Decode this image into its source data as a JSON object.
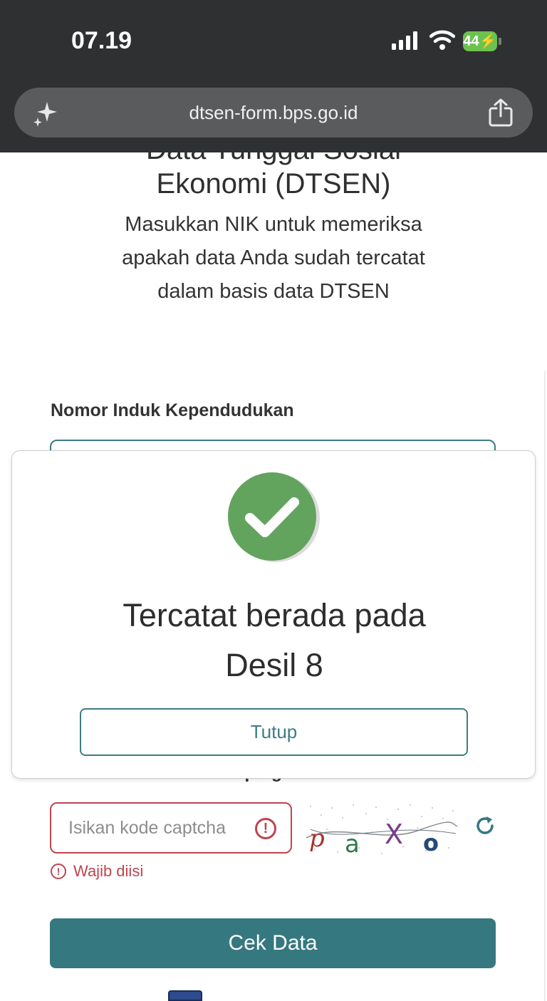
{
  "status_bar": {
    "time": "07.19",
    "battery": "44"
  },
  "browser": {
    "url": "dtsen-form.bps.go.id"
  },
  "header": {
    "title": "Data Tunggal Sosial\nEkonomi (DTSEN)",
    "subtitle": "Masukkan NIK untuk memeriksa\napakah data Anda sudah tercatat\ndalam basis data DTSEN"
  },
  "form": {
    "nik_label": "Nomor Induk Kependudukan",
    "captcha_label": "Masukkan kode di samping",
    "captcha_placeholder": "Isikan kode captcha",
    "captcha_error": "Wajib diisi",
    "captcha_chars": [
      "p",
      "a",
      "X",
      "o"
    ],
    "submit_label": "Cek Data"
  },
  "modal": {
    "message": "Tercatat berada pada\nDesil 8",
    "close_label": "Tutup",
    "icon": "check-circle-icon"
  },
  "colors": {
    "accent": "#35787f",
    "success": "#62a35e",
    "error": "#c0444e",
    "chrome": "#2f3031"
  }
}
